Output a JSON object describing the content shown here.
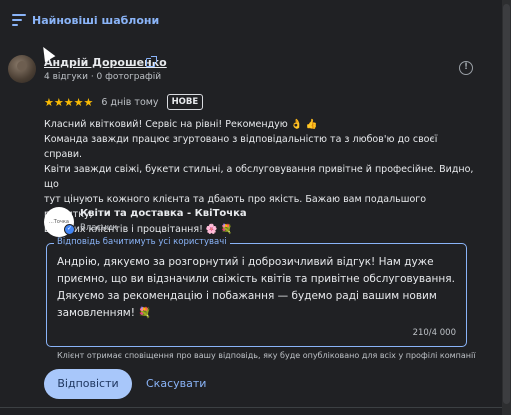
{
  "header": {
    "sort_label": "Найновіші шаблони",
    "sort_icon": "sort-icon"
  },
  "review": {
    "author_name": "Андрій Дорошенко",
    "author_meta": "4 відгуки · 0 фотографій",
    "stars": "★★★★★",
    "rating": 5,
    "time": "6 днів тому",
    "badge": "НОВЕ",
    "text_lines": [
      "Класний квітковий! Сервіс на рівні! Рекомендую 👌 👍",
      "Команда завжди працює згуртовано з відповідальністю та з любов'ю до своєї справи.",
      "Квіти завжди свіжі, букети стильні, а обслуговування привітне й професійне. Видно, що",
      "тут цінують кожного клієнта та дбають про якість. Бажаю вам подальшого розвитку,",
      "вдячних клієнтів і процвітання! 🌸 💐"
    ]
  },
  "owner": {
    "logo_text": "...Точка",
    "name": "Квіти та доставка - КвіТочка",
    "role": "Власник"
  },
  "reply": {
    "legend": "Відповідь бачитимуть усі користувачі",
    "lines": [
      "Андрію, дякуємо за розгорнутий і доброзичливий відгук! Нам дуже",
      "приємно, що ви відзначили свіжість квітів та привітне обслуговування.",
      "Дякуємо за рекомендацію і побажання — будемо раді вашим новим",
      "замовленням! 💐"
    ],
    "char_count": "210/4 000"
  },
  "notice": "Клієнт отримає сповіщення про вашу відповідь, яку буде опубліковано для всіх у профілі компанії",
  "actions": {
    "reply_label": "Відповісти",
    "cancel_label": "Скасувати"
  },
  "colors": {
    "background": "#202124",
    "accent": "#8ab4f8",
    "star": "#fbbc04",
    "primary_button": "#a8c7fa"
  }
}
